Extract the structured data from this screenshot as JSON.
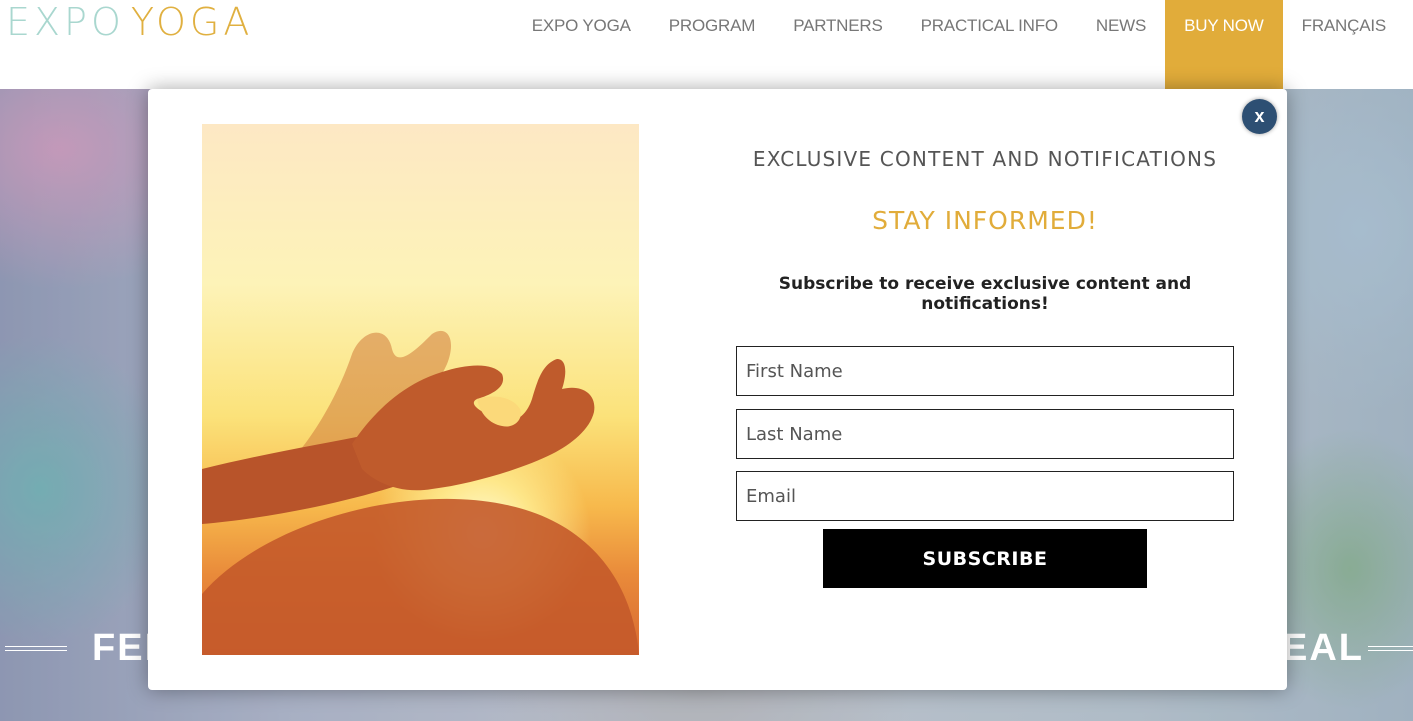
{
  "logo": {
    "part1": "EXPO",
    "part2": "YOGA"
  },
  "nav": {
    "items": [
      {
        "label": "EXPO YOGA"
      },
      {
        "label": "PROGRAM"
      },
      {
        "label": "PARTNERS"
      },
      {
        "label": "PRACTICAL INFO"
      },
      {
        "label": "NEWS"
      },
      {
        "label": "BUY NOW"
      },
      {
        "label": "FRANÇAIS"
      }
    ]
  },
  "hero": {
    "title_left_fragment": "FEE",
    "title_right_fragment": "EAL"
  },
  "modal": {
    "close_label": "x",
    "heading": "EXCLUSIVE CONTENT AND NOTIFICATIONS",
    "subheading": "STAY INFORMED!",
    "description": "Subscribe to receive exclusive content and notifications!",
    "fields": {
      "first_name_placeholder": "First Name",
      "last_name_placeholder": "Last Name",
      "email_placeholder": "Email"
    },
    "submit_label": "SUBSCRIBE"
  },
  "colors": {
    "accent": "#e1ac3a",
    "close_button": "#2d4f73",
    "logo_teal": "#a9d7cf"
  }
}
